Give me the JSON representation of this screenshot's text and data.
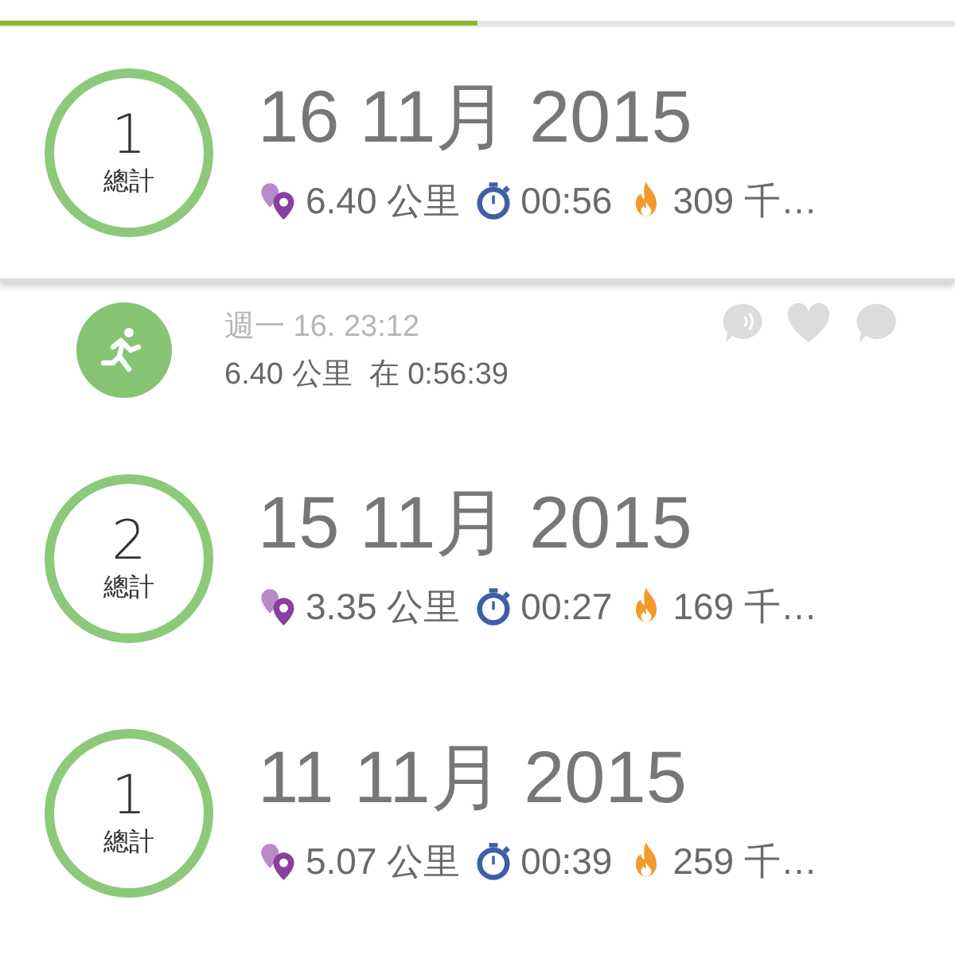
{
  "progress": {
    "level": 0.5
  },
  "days": [
    {
      "count": "1",
      "count_label": "總計",
      "date": "16 11月 2015",
      "distance": "6.40 公里",
      "duration": "00:56",
      "calories": "309 千…",
      "expanded": true,
      "activities": [
        {
          "time": "週一 16. 23:12",
          "summary": "6.40 公里  在 0:56:39"
        }
      ]
    },
    {
      "count": "2",
      "count_label": "總計",
      "date": "15 11月 2015",
      "distance": "3.35 公里",
      "duration": "00:27",
      "calories": "169 千…",
      "expanded": false
    },
    {
      "count": "1",
      "count_label": "總計",
      "date": "11 11月 2015",
      "distance": "5.07 公里",
      "duration": "00:39",
      "calories": "259 千…",
      "expanded": false
    }
  ]
}
